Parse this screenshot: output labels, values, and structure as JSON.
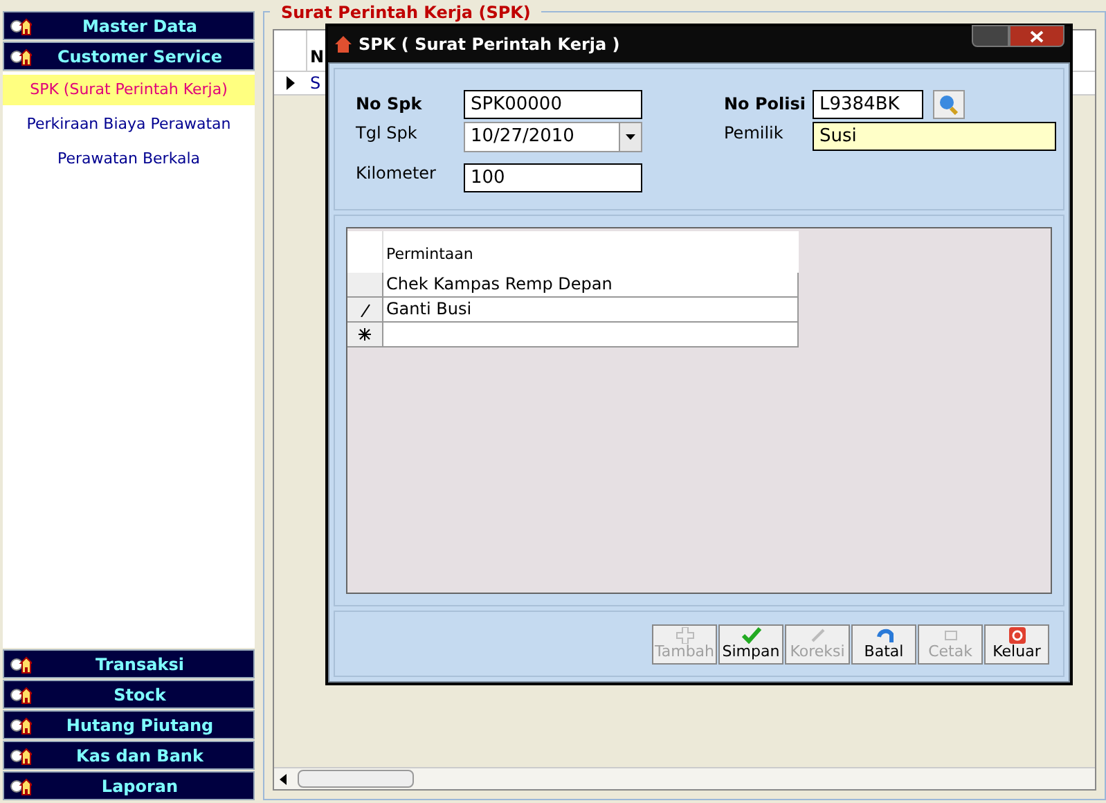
{
  "sidebar": {
    "top_groups": [
      {
        "label": "Master Data"
      },
      {
        "label": "Customer Service"
      }
    ],
    "items": [
      {
        "label": "SPK (Surat Perintah Kerja)",
        "selected": true
      },
      {
        "label": "Perkiraan Biaya Perawatan",
        "selected": false
      },
      {
        "label": "Perawatan Berkala",
        "selected": false
      }
    ],
    "bottom_groups": [
      {
        "label": "Transaksi"
      },
      {
        "label": "Stock"
      },
      {
        "label": "Hutang Piutang"
      },
      {
        "label": "Kas dan Bank"
      },
      {
        "label": "Laporan"
      }
    ]
  },
  "background_form": {
    "title": "Surat Perintah Kerja (SPK)",
    "column_1": "N",
    "cell": "S"
  },
  "dialog": {
    "title": "SPK ( Surat Perintah Kerja )",
    "no_spk": {
      "label": "No Spk",
      "value": "SPK00000"
    },
    "tgl_spk": {
      "label": "Tgl Spk",
      "value": "10/27/2010"
    },
    "kilometer": {
      "label": "Kilometer",
      "value": "100"
    },
    "no_polisi": {
      "label": "No Polisi",
      "value": "L9384BK"
    },
    "pemilik": {
      "label": "Pemilik",
      "value": "Susi"
    },
    "grid": {
      "column": "Permintaan",
      "rows": [
        {
          "kind": "plain",
          "text": "Chek Kampas Remp Depan"
        },
        {
          "kind": "editing",
          "text": "Ganti Busi"
        },
        {
          "kind": "new"
        }
      ]
    },
    "buttons": [
      {
        "label": "Tambah",
        "disabled": true
      },
      {
        "label": "Simpan",
        "disabled": false
      },
      {
        "label": "Koreksi",
        "disabled": true
      },
      {
        "label": "Batal",
        "disabled": false
      },
      {
        "label": "Cetak",
        "disabled": true
      },
      {
        "label": "Keluar",
        "disabled": false
      }
    ]
  }
}
